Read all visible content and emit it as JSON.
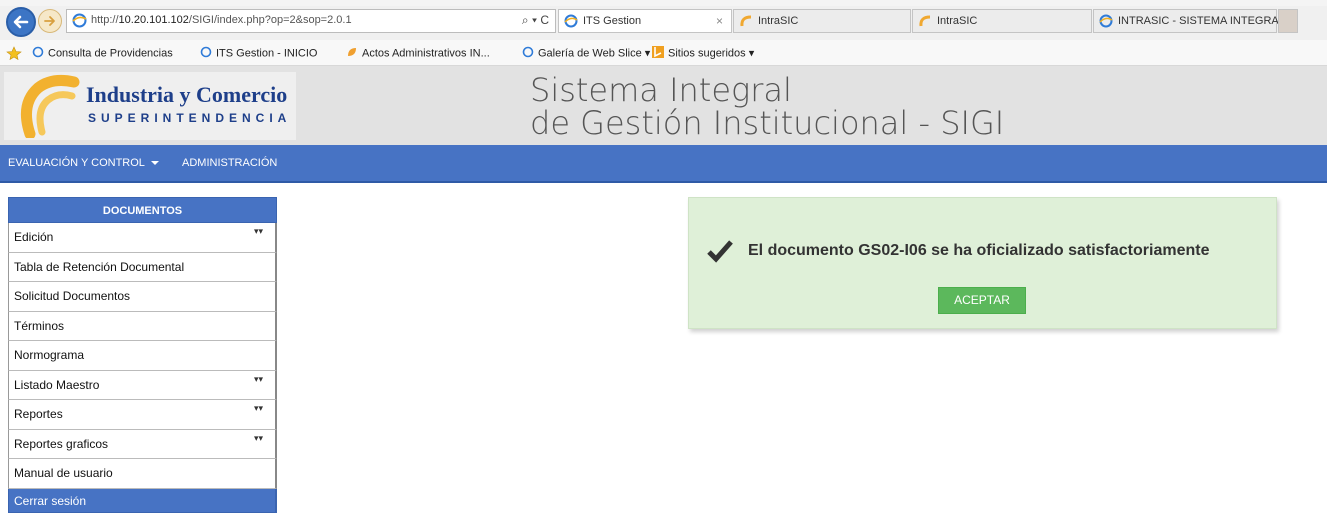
{
  "browser": {
    "address": {
      "prefix": "http://",
      "host": "10.20.101.102",
      "path": "/SIGI/index.php?op=2&sop=2.0.1"
    },
    "address_tools": "⌕ ▾ C",
    "tabs": [
      {
        "label": "ITS Gestion",
        "close": "×"
      },
      {
        "label": "IntraSIC"
      },
      {
        "label": "IntraSIC"
      },
      {
        "label": "INTRASIC - SISTEMA INTEGRA..."
      }
    ],
    "favorites": [
      {
        "label": "Consulta de Providencias"
      },
      {
        "label": "ITS Gestion - INICIO"
      },
      {
        "label": "Actos Administrativos IN..."
      },
      {
        "label": "Galería de Web Slice ▾"
      },
      {
        "label": "Sitios sugeridos ▾"
      }
    ]
  },
  "header": {
    "logo_line1": "Industria y Comercio",
    "logo_line2": "SUPERINTENDENCIA",
    "title_line1": "Sistema Integral",
    "title_line2": "de Gestión Institucional - SIGI"
  },
  "nav": {
    "items": [
      {
        "label": "EVALUACIÓN Y CONTROL"
      },
      {
        "label": "ADMINISTRACIÓN"
      }
    ]
  },
  "sidebar": {
    "header": "DOCUMENTOS",
    "items": [
      {
        "label": "Edición"
      },
      {
        "label": "Tabla de Retención Documental"
      },
      {
        "label": "Solicitud Documentos"
      },
      {
        "label": "Términos"
      },
      {
        "label": "Normograma"
      },
      {
        "label": "Listado Maestro"
      },
      {
        "label": "Reportes"
      },
      {
        "label": "Reportes graficos"
      },
      {
        "label": "Manual de usuario"
      }
    ],
    "logout": "Cerrar sesión",
    "chevron": "▾▾"
  },
  "alert": {
    "message": "El documento GS02-I06 se ha oficializado satisfactoriamente",
    "button": "ACEPTAR"
  },
  "colors": {
    "nav_blue": "#4773c4",
    "success_bg": "#dff0d8",
    "success_button": "#5cb85c",
    "logo_blue": "#1e3f8a"
  }
}
